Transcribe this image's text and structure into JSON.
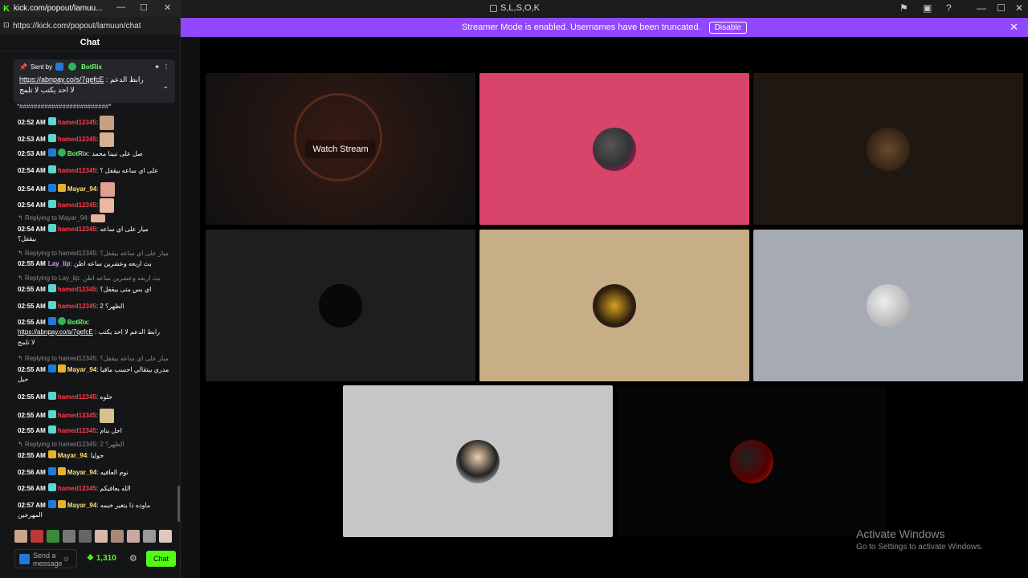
{
  "window": {
    "title": "S,L,S,O,K"
  },
  "banner": {
    "text": "Streamer Mode is enabled. Usernames have been truncated.",
    "button": "Disable"
  },
  "popout": {
    "title": "kick.com/popout/lamuu...",
    "url": "https://kick.com/popout/lamuun/chat",
    "chat_title": "Chat",
    "pinned": {
      "sent_by": "Sent by",
      "user": "BotRix",
      "link": "https://abnpay.co/s/7qefcE",
      "text": ": رابط الدعم",
      "text2": "لا احد يكتب لا تلمح"
    },
    "truncated_line": "*#########################*",
    "messages": [
      {
        "time": "02:52 AM",
        "user": "hamed12345",
        "text": ":"
      },
      {
        "time": "02:53 AM",
        "user": "hamed12345",
        "text": ":"
      },
      {
        "time": "02:53 AM",
        "user": "BotRix",
        "text": ": صل على نبينا محمد"
      },
      {
        "time": "02:54 AM",
        "user": "hamed12345",
        "text": ": على اي ساعه بيقفل ؟"
      },
      {
        "time": "02:54 AM",
        "user": "Mayar_94",
        "text": ":"
      },
      {
        "time": "02:54 AM",
        "user": "hamed12345",
        "text": ":"
      },
      {
        "time": "02:54 AM",
        "user": "hamed12345",
        "text": ": ميار على اي ساعه",
        "text2": "بيقفل؟",
        "reply": "Replying to Mayar_94:"
      },
      {
        "time": "02:55 AM",
        "user": "Lay_lip",
        "text": ": بث اربعه وعشرين ساعه اظن",
        "reply": "Replying to hamed12345: ميار على اي ساعه بيقفل؟"
      },
      {
        "time": "02:55 AM",
        "user": "hamed12345",
        "text": ": اي بس متى بيقفل؟",
        "reply": "Replying to Lay_lip: بث اربعه وعشرين ساعه اظن"
      },
      {
        "time": "02:55 AM",
        "user": "hamed12345",
        "text": ": الظهر؟ 2"
      },
      {
        "time": "02:55 AM",
        "user": "BotRix",
        "text": ":",
        "link": "https://abnpay.co/s/7qefcE",
        "text2": ": رابط الدعم لا احد يكتب",
        "text3": "لا تلمح"
      },
      {
        "time": "02:55 AM",
        "user": "Mayar_94",
        "text": ": مدري بيتقالي احسب مافيا",
        "text2": "حيل",
        "reply": "Replying to hamed12345: ميار على اي ساعه بيقفل؟"
      },
      {
        "time": "02:55 AM",
        "user": "hamed12345",
        "text": ": حلوه"
      },
      {
        "time": "02:55 AM",
        "user": "hamed12345",
        "text": ":"
      },
      {
        "time": "02:55 AM",
        "user": "hamed12345",
        "text": ": اجل بنام"
      },
      {
        "time": "02:55 AM",
        "user": "Mayar_94",
        "text": ": حوليا",
        "reply": "Replying to hamed12345: الظهر؟ 2"
      },
      {
        "time": "02:56 AM",
        "user": "Mayar_94",
        "text": ": نوم العافيه"
      },
      {
        "time": "02:56 AM",
        "user": "hamed12345",
        "text": ": الله يعافيكم"
      },
      {
        "time": "02:57 AM",
        "user": "Mayar_94",
        "text": ": ماوده ذا يتغير خيمه",
        "text2": "المهرجين"
      }
    ],
    "composer": {
      "placeholder": "Send a message"
    },
    "points": "1,310",
    "chat_button": "Chat"
  },
  "tiles": [
    {
      "label": "Watch Stream"
    }
  ],
  "activate": {
    "line1": "Activate Windows",
    "line2": "Go to Settings to activate Windows."
  },
  "colors": {
    "accent": "#53fc18",
    "banner": "#9146ff"
  }
}
